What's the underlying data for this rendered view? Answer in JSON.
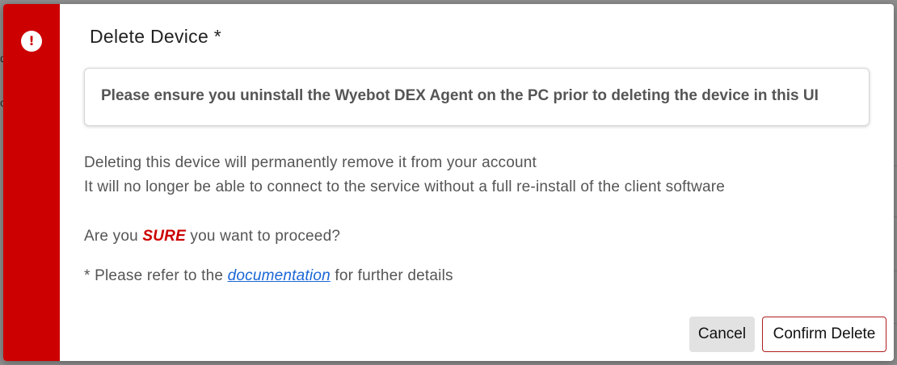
{
  "dialog": {
    "title": "Delete Device *",
    "alert_icon_glyph": "!",
    "warning": "Please ensure you uninstall the Wyebot DEX Agent on the PC prior to deleting the device in this UI",
    "line1": "Deleting this device will permanently remove it from your account",
    "line2": "It will no longer be able to connect to the service without a full re-install of the client software",
    "confirm_prefix": "Are you ",
    "confirm_emphasis": "SURE",
    "confirm_suffix": " you want to proceed?",
    "note_prefix": "* Please refer to the ",
    "note_link": "documentation",
    "note_suffix": " for further details",
    "cancel_label": "Cancel",
    "confirm_label": "Confirm Delete"
  },
  "colors": {
    "danger": "#cc0000",
    "link": "#1a66d6",
    "confirm_border": "#b01e1e"
  },
  "background": {
    "left_fragments": [
      "d",
      "o"
    ]
  }
}
